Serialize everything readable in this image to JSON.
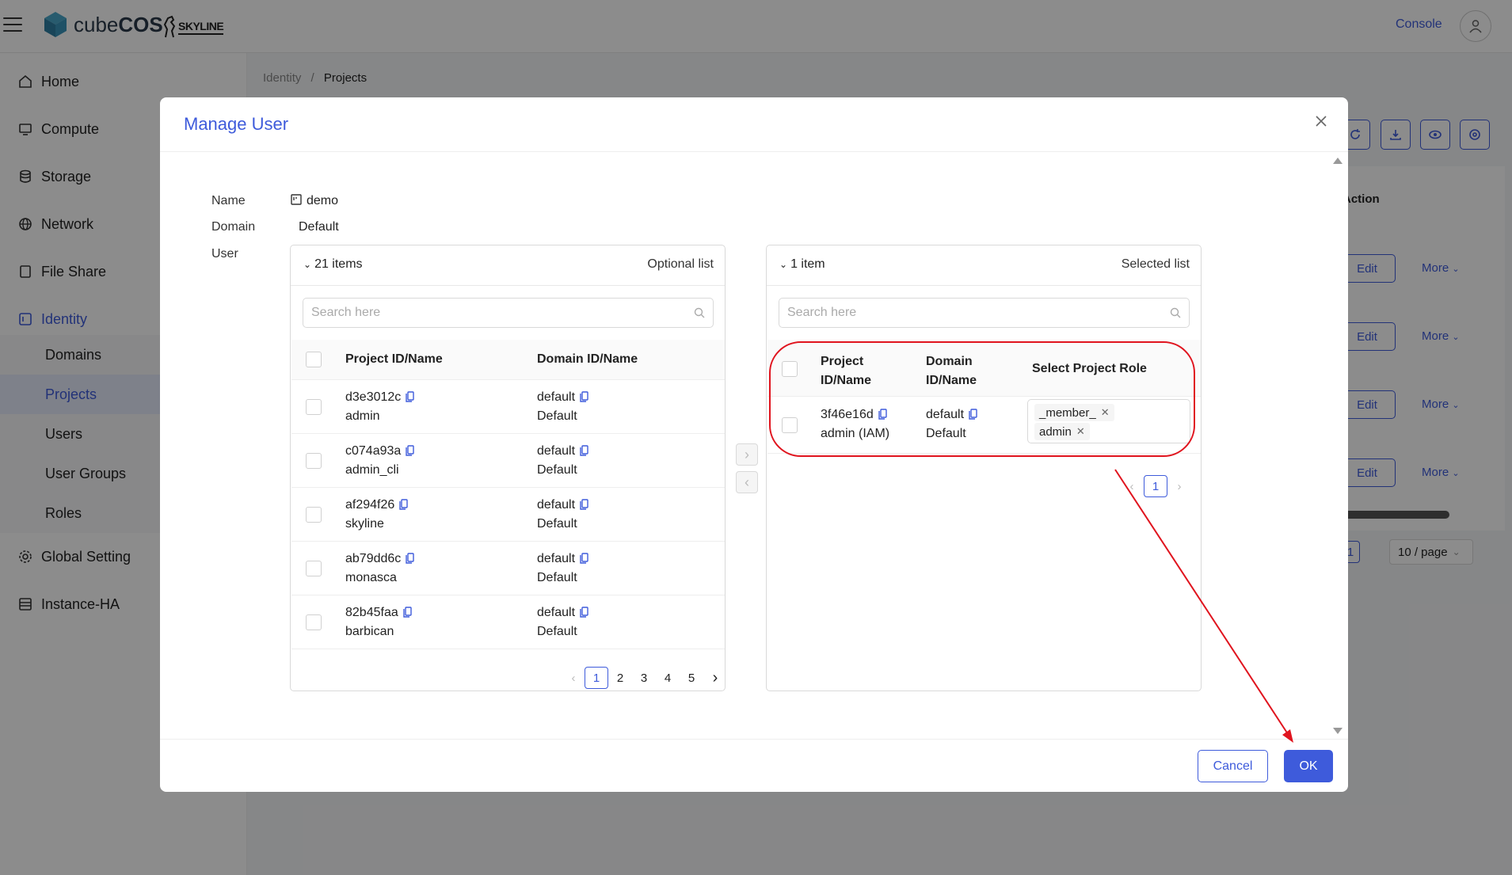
{
  "topbar": {
    "logo_text_a": "cube",
    "logo_text_b": "COS",
    "partner_logo": "SKYLINE",
    "console_label": "Console"
  },
  "sidebar": {
    "items": [
      {
        "label": "Home",
        "icon": "home-icon"
      },
      {
        "label": "Compute",
        "icon": "monitor-icon"
      },
      {
        "label": "Storage",
        "icon": "database-icon"
      },
      {
        "label": "Network",
        "icon": "globe-icon"
      },
      {
        "label": "File Share",
        "icon": "file-icon"
      },
      {
        "label": "Identity",
        "icon": "id-card-icon"
      },
      {
        "label": "Global Setting",
        "icon": "gear-icon"
      },
      {
        "label": "Instance-HA",
        "icon": "server-icon"
      }
    ],
    "identity_sub": [
      "Domains",
      "Projects",
      "Users",
      "User Groups",
      "Roles"
    ],
    "active_item": "Identity",
    "active_sub": "Projects"
  },
  "breadcrumb": {
    "root": "Identity",
    "separator": "/",
    "current": "Projects"
  },
  "background_table": {
    "action_header": "Action",
    "edit_label": "Edit",
    "more_label": "More",
    "page_num": "1",
    "page_size": "10 / page"
  },
  "modal": {
    "title": "Manage User",
    "name_label": "Name",
    "name_value": "demo",
    "domain_label": "Domain",
    "domain_value": "Default",
    "user_label": "User",
    "cancel_label": "Cancel",
    "ok_label": "OK"
  },
  "optional_list": {
    "count": "21 items",
    "title": "Optional list",
    "search_placeholder": "Search here",
    "col_project": "Project ID/Name",
    "col_domain": "Domain ID/Name",
    "rows": [
      {
        "id": "d3e3012c",
        "name": "admin",
        "domain_id": "default",
        "domain_name": "Default"
      },
      {
        "id": "c074a93a",
        "name": "admin_cli",
        "domain_id": "default",
        "domain_name": "Default"
      },
      {
        "id": "af294f26",
        "name": "skyline",
        "domain_id": "default",
        "domain_name": "Default"
      },
      {
        "id": "ab79dd6c",
        "name": "monasca",
        "domain_id": "default",
        "domain_name": "Default"
      },
      {
        "id": "82b45faa",
        "name": "barbican",
        "domain_id": "default",
        "domain_name": "Default"
      }
    ],
    "pages": [
      "1",
      "2",
      "3",
      "4",
      "5"
    ],
    "current_page": "1"
  },
  "selected_list": {
    "count": "1 item",
    "title": "Selected list",
    "search_placeholder": "Search here",
    "col_project_a": "Project",
    "col_project_b": "ID/Name",
    "col_domain_a": "Domain",
    "col_domain_b": "ID/Name",
    "col_role": "Select Project Role",
    "rows": [
      {
        "id": "3f46e16d",
        "name": "admin (IAM)",
        "domain_id": "default",
        "domain_name": "Default",
        "roles": [
          "_member_",
          "admin"
        ]
      }
    ],
    "current_page": "1"
  },
  "colors": {
    "accent": "#3e5bdb",
    "annotation": "#e0141e",
    "overlay": "rgba(0,0,0,0.45)"
  }
}
